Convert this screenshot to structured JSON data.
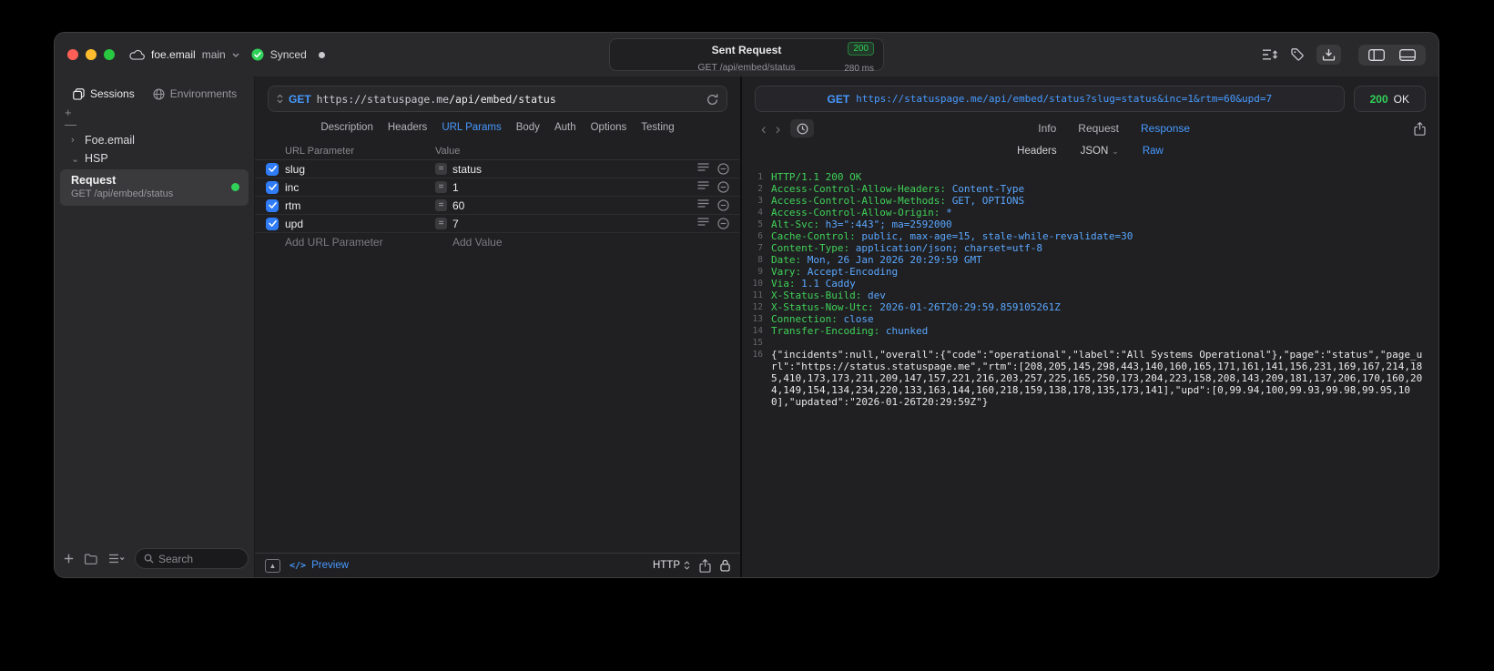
{
  "titlebar": {
    "project": "foe.email",
    "branch": "main",
    "sync_label": "Synced",
    "capsule": {
      "title": "Sent Request",
      "status_code": "200",
      "subtitle": "GET /api/embed/status",
      "duration": "280 ms"
    }
  },
  "sidebar": {
    "tabs": [
      {
        "label": "Sessions"
      },
      {
        "label": "Environments"
      }
    ],
    "groups": [
      {
        "label": "Foe.email",
        "expanded": false
      },
      {
        "label": "HSP",
        "expanded": true
      }
    ],
    "request_item": {
      "title": "Request",
      "subtitle": "GET /api/embed/status"
    },
    "search": {
      "placeholder": "Search"
    }
  },
  "request_panel": {
    "method": "GET",
    "url_domain": "https://statuspage.me",
    "url_path": "/api/embed/status",
    "tabs": [
      "Description",
      "Headers",
      "URL Params",
      "Body",
      "Auth",
      "Options",
      "Testing"
    ],
    "active_tab": "URL Params",
    "params": {
      "columns": [
        "URL Parameter",
        "Value"
      ],
      "rows": [
        {
          "name": "slug",
          "value": "status",
          "checked": true
        },
        {
          "name": "inc",
          "value": "1",
          "checked": true
        },
        {
          "name": "rtm",
          "value": "60",
          "checked": true
        },
        {
          "name": "upd",
          "value": "7",
          "checked": true
        }
      ],
      "add_name_placeholder": "Add URL Parameter",
      "add_value_placeholder": "Add Value"
    },
    "footer": {
      "preview": "Preview",
      "code_glyph": "</>",
      "protocol": "HTTP"
    }
  },
  "response_panel": {
    "request_pill": {
      "method": "GET",
      "url": "https://statuspage.me/api/embed/status?slug=status&inc=1&rtm=60&upd=7"
    },
    "status_pill": {
      "code": "200",
      "text": "OK"
    },
    "tabs": [
      "Info",
      "Request",
      "Response"
    ],
    "active_tab": "Response",
    "subtabs": [
      {
        "label": "Headers",
        "chevron": false
      },
      {
        "label": "JSON",
        "chevron": true
      },
      {
        "label": "Raw",
        "chevron": false
      }
    ],
    "active_subtab": "Raw",
    "body": {
      "status_line": "HTTP/1.1 200 OK",
      "headers": [
        {
          "name": "Access-Control-Allow-Headers",
          "value": "Content-Type"
        },
        {
          "name": "Access-Control-Allow-Methods",
          "value": "GET, OPTIONS"
        },
        {
          "name": "Access-Control-Allow-Origin",
          "value": "*"
        },
        {
          "name": "Alt-Svc",
          "value": "h3=\":443\"; ma=2592000"
        },
        {
          "name": "Cache-Control",
          "value": "public, max-age=15, stale-while-revalidate=30"
        },
        {
          "name": "Content-Type",
          "value": "application/json; charset=utf-8"
        },
        {
          "name": "Date",
          "value": "Mon, 26 Jan 2026 20:29:59 GMT"
        },
        {
          "name": "Vary",
          "value": "Accept-Encoding"
        },
        {
          "name": "Via",
          "value": "1.1 Caddy"
        },
        {
          "name": "X-Status-Build",
          "value": "dev"
        },
        {
          "name": "X-Status-Now-Utc",
          "value": "2026-01-26T20:29:59.859105261Z"
        },
        {
          "name": "Connection",
          "value": "close"
        },
        {
          "name": "Transfer-Encoding",
          "value": "chunked"
        }
      ],
      "json_body": "{\"incidents\":null,\"overall\":{\"code\":\"operational\",\"label\":\"All Systems Operational\"},\"page\":\"status\",\"page_url\":\"https://status.statuspage.me\",\"rtm\":[208,205,145,298,443,140,160,165,171,161,141,156,231,169,167,214,185,410,173,173,211,209,147,157,221,216,203,257,225,165,250,173,204,223,158,208,143,209,181,137,206,170,160,204,149,154,134,234,220,133,163,144,160,218,159,138,178,135,173,141],\"upd\":[0,99.94,100,99.93,99.98,99.95,100],\"updated\":\"2026-01-26T20:29:59Z\"}"
    }
  },
  "colors": {
    "accent_blue": "#4799ff",
    "status_green": "#30d158",
    "header_name_green": "#3fd158",
    "header_value_blue": "#5aa7ff"
  }
}
